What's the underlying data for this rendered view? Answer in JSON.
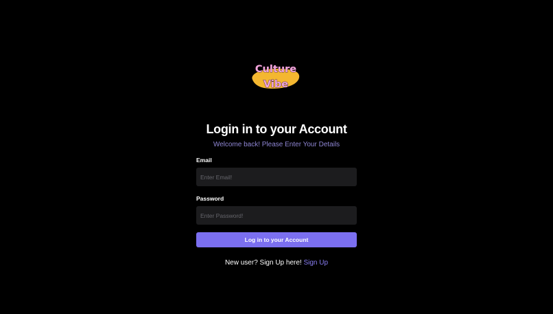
{
  "brand": {
    "logo_line1": "Culture",
    "logo_line2": "Vibe",
    "logo_text_color": "#f2a7dc",
    "logo_blob_color": "#f4b730"
  },
  "heading": {
    "title": "Login in to your Account",
    "subtitle": "Welcome back! Please Enter Your Details"
  },
  "form": {
    "email_label": "Email",
    "email_placeholder": "Enter Email!",
    "email_value": "",
    "password_label": "Password",
    "password_placeholder": "Enter Password!",
    "password_value": "",
    "submit_label": "Log in to your Account"
  },
  "footer": {
    "prompt": "New user? Sign Up here!",
    "link_label": "Sign Up"
  },
  "colors": {
    "background": "#000000",
    "accent": "#7b6ff0",
    "input_background": "#1c1c1e",
    "subtitle": "#8f86d4"
  }
}
